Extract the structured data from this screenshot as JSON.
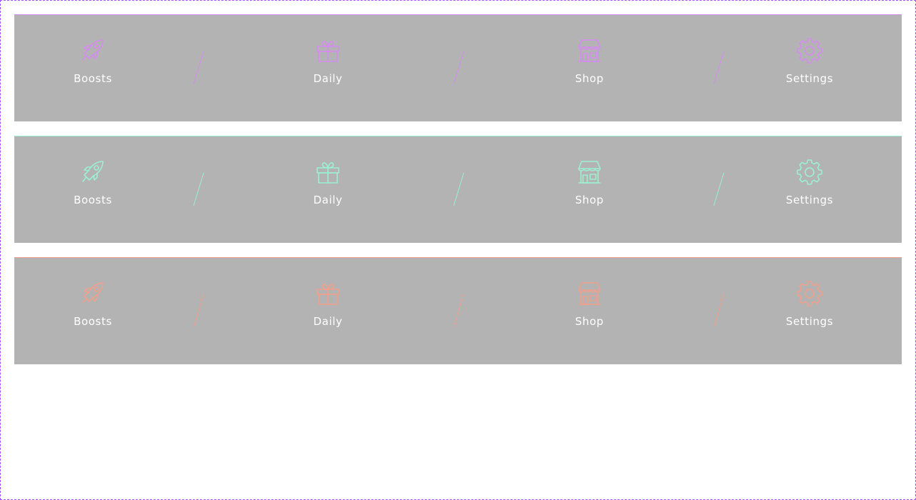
{
  "themes": [
    {
      "accent": "#d58cf0"
    },
    {
      "accent": "#9cf0d3"
    },
    {
      "accent": "#f0a08c"
    }
  ],
  "nav": {
    "items": [
      {
        "label": "Boosts",
        "icon": "rocket-icon"
      },
      {
        "label": "Daily",
        "icon": "gift-icon"
      },
      {
        "label": "Shop",
        "icon": "shop-icon"
      },
      {
        "label": "Settings",
        "icon": "gear-icon"
      }
    ]
  }
}
